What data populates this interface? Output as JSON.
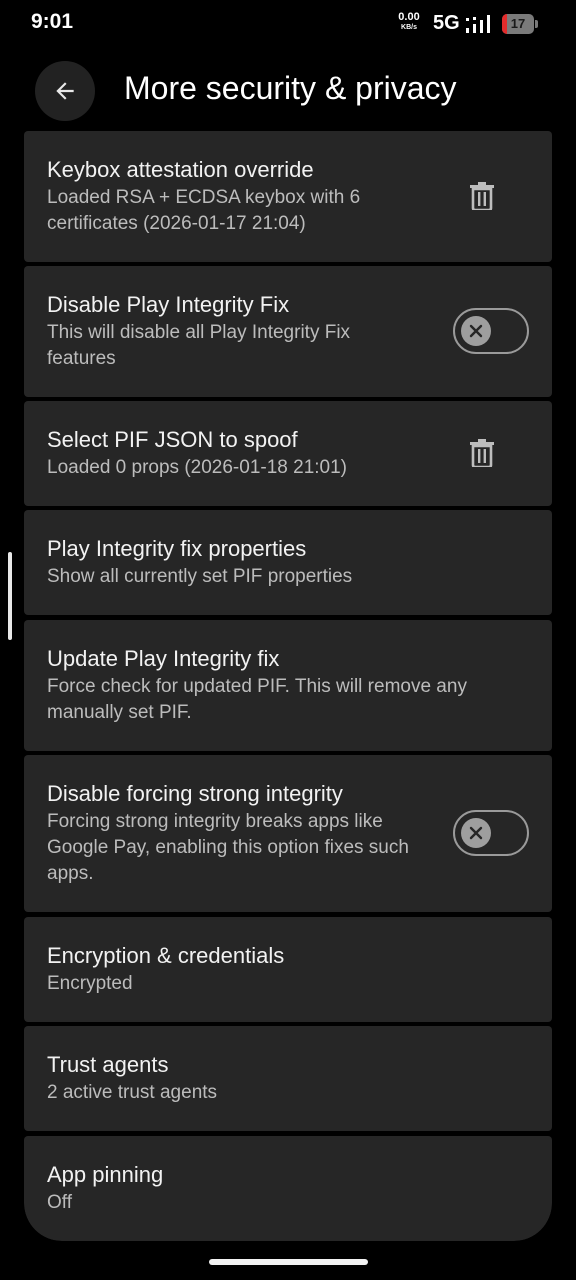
{
  "status_bar": {
    "time": "9:01",
    "net_speed_value": "0.00",
    "net_speed_unit": "KB/s",
    "network_type": "5G",
    "battery_level": "17",
    "battery_fraction": 0.17
  },
  "header": {
    "title": "More security & privacy"
  },
  "settings": [
    {
      "title": "Keybox attestation override",
      "summary": "Loaded RSA + ECDSA keybox with 6 certificates (2026-01-17 21:04)",
      "control": "trash-icon"
    },
    {
      "title": "Disable Play Integrity Fix",
      "summary": "This will disable all Play Integrity Fix features",
      "control": "toggle",
      "checked": false
    },
    {
      "title": "Select PIF JSON to spoof",
      "summary": "Loaded 0 props (2026-01-18 21:01)",
      "control": "trash-icon"
    },
    {
      "title": "Play Integrity fix properties",
      "summary": "Show all currently set PIF properties"
    },
    {
      "title": "Update Play Integrity fix",
      "summary": "Force check for updated PIF. This will remove any manually set PIF."
    },
    {
      "title": "Disable forcing strong integrity",
      "summary": "Forcing strong integrity breaks apps like Google Pay, enabling this option fixes such apps.",
      "control": "toggle",
      "checked": false
    },
    {
      "title": "Encryption & credentials",
      "summary": "Encrypted"
    },
    {
      "title": "Trust agents",
      "summary": "2 active trust agents"
    },
    {
      "title": "App pinning",
      "summary": "Off"
    }
  ],
  "colors": {
    "background": "#000000",
    "card": "#262626",
    "title_text": "#f2f2f2",
    "summary_text": "#bcbcbc",
    "battery_low": "#e32b2b",
    "toggle_off": "#9e9e9e"
  }
}
